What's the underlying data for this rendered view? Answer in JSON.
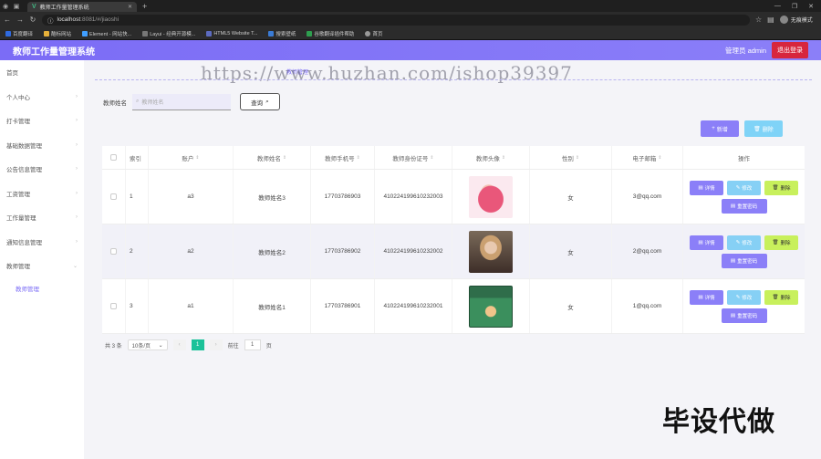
{
  "browser": {
    "tab_title": "教师工作量管理系统",
    "url_host": "localhost",
    "url_rest": ":8081/#/jiaoshi",
    "profile": "无痕模式",
    "bookmarks": [
      "百度翻译",
      "酷标网站",
      "Element - 网站快...",
      "Layui - 经典开源模...",
      "HTML5 Website T...",
      "搜索壁纸",
      "谷歌翻译插件帮助",
      "首页"
    ],
    "colors": {
      "tab_bg": "#3a3a3a",
      "chrome": "#2b2b2b"
    }
  },
  "header": {
    "title": "教师工作量管理系统",
    "admin": "管理员 admin",
    "logout": "退出登录",
    "color": "#7b6cf6"
  },
  "sidebar": {
    "items": [
      {
        "label": "首页"
      },
      {
        "label": "个人中心"
      },
      {
        "label": "打卡管理"
      },
      {
        "label": "基础数据管理"
      },
      {
        "label": "公告信息管理"
      },
      {
        "label": "工资管理"
      },
      {
        "label": "工作量管理"
      },
      {
        "label": "通知信息管理"
      },
      {
        "label": "教师管理"
      }
    ],
    "sub_item": "教师管理"
  },
  "watermark": "https://www.huzhan.com/ishop39397",
  "breadcrumb": "教师管理",
  "search": {
    "label": "教师姓名",
    "placeholder": "教师姓名",
    "button": "查询"
  },
  "actions": {
    "add": "新增",
    "delete": "删除"
  },
  "table": {
    "headers": [
      "索引",
      "账户",
      "教师姓名",
      "教师手机号",
      "教师身份证号",
      "教师头像",
      "性别",
      "电子邮箱",
      "操作"
    ],
    "rows": [
      {
        "index": "1",
        "account": "a3",
        "name": "教师姓名3",
        "phone": "17703786903",
        "idcard": "410224199610232003",
        "gender": "女",
        "email": "3@qq.com"
      },
      {
        "index": "2",
        "account": "a2",
        "name": "教师姓名2",
        "phone": "17703786902",
        "idcard": "410224199610232002",
        "gender": "女",
        "email": "2@qq.com"
      },
      {
        "index": "3",
        "account": "a1",
        "name": "教师姓名1",
        "phone": "17703786901",
        "idcard": "410224199610232001",
        "gender": "女",
        "email": "1@qq.com"
      }
    ],
    "ops": {
      "detail": "详情",
      "edit": "修改",
      "del": "删除",
      "reset": "重置密码"
    }
  },
  "pager": {
    "total": "共 3 条",
    "size": "10条/页",
    "page": "1",
    "goto_label": "前往",
    "goto_value": "1",
    "page_suffix": "页"
  },
  "corner_text": "毕设代做"
}
